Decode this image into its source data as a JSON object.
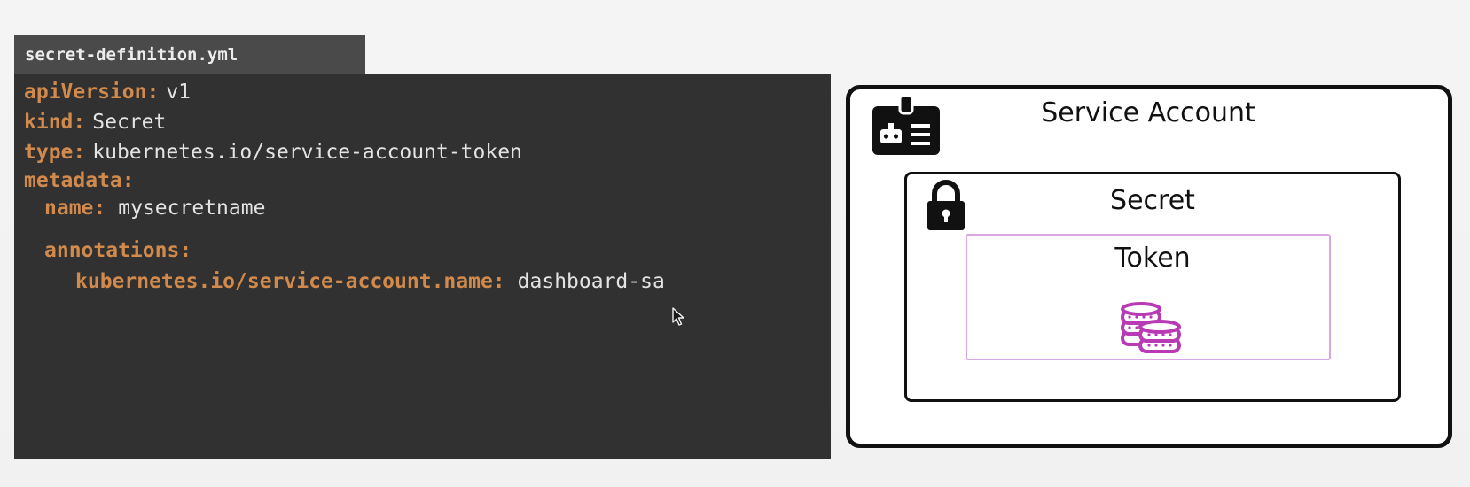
{
  "file_tab": {
    "filename": "secret-definition.yml"
  },
  "code": {
    "lines": [
      {
        "key": "apiVersion:",
        "value": "v1"
      },
      {
        "key": "kind:",
        "value": "Secret"
      },
      {
        "key": "type:",
        "value": "kubernetes.io/service-account-token"
      },
      {
        "key": "metadata:",
        "value": ""
      },
      {
        "key": "name:",
        "value": "mysecretname"
      },
      {
        "key": "annotations:",
        "value": ""
      },
      {
        "key": "kubernetes.io/service-account.name:",
        "value": "dashboard-sa"
      }
    ]
  },
  "diagram": {
    "service_account_label": "Service Account",
    "secret_label": "Secret",
    "token_label": "Token",
    "icons": {
      "service_account": "id-badge-robot-icon",
      "secret": "lock-icon",
      "token": "coins-icon",
      "cursor": "mouse-pointer-icon"
    },
    "colors": {
      "yaml_key": "#d18a4c",
      "yaml_value": "#e3e3e3",
      "code_background": "#313131",
      "token_accent": "#b93ab5",
      "token_border": "#d8a6e0"
    }
  }
}
